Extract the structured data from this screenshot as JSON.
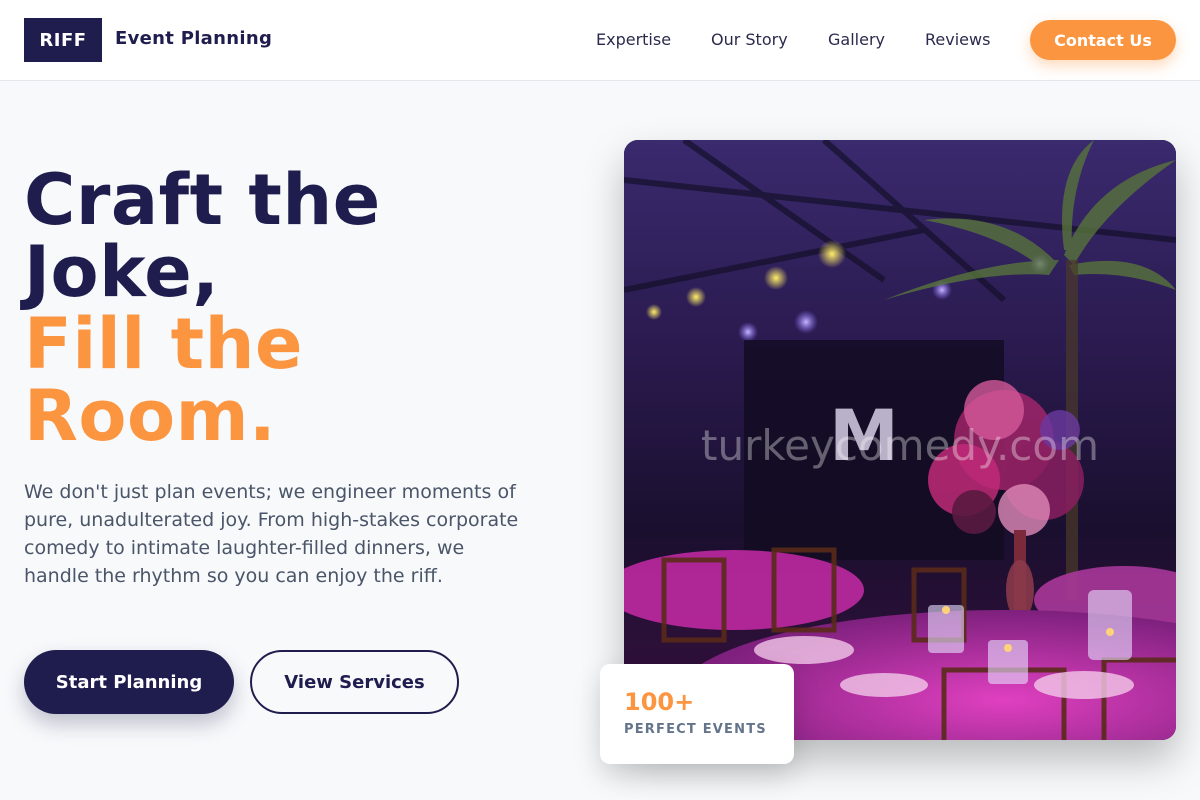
{
  "nav": {
    "logo": "RIFF",
    "brand": "Event Planning",
    "links": [
      "Expertise",
      "Our Story",
      "Gallery",
      "Reviews"
    ],
    "cta": "Contact Us"
  },
  "hero": {
    "title_line1": "Craft the",
    "title_line2": "Joke,",
    "title_line3": "Fill the",
    "title_line4": "Room.",
    "description": "We don't just plan events; we engineer moments of pure, unadulterated joy. From high-stakes corporate comedy to intimate laughter-filled dinners, we handle the rhythm so you can enjoy the riff.",
    "primary_button": "Start Planning",
    "secondary_button": "View Services",
    "image_watermark": "turkeycomedy.com"
  },
  "stat": {
    "number": "100+",
    "label": "PERFECT EVENTS"
  },
  "colors": {
    "navy": "#1f1d4d",
    "accent": "#fb9540",
    "background": "#f7f9fb"
  }
}
